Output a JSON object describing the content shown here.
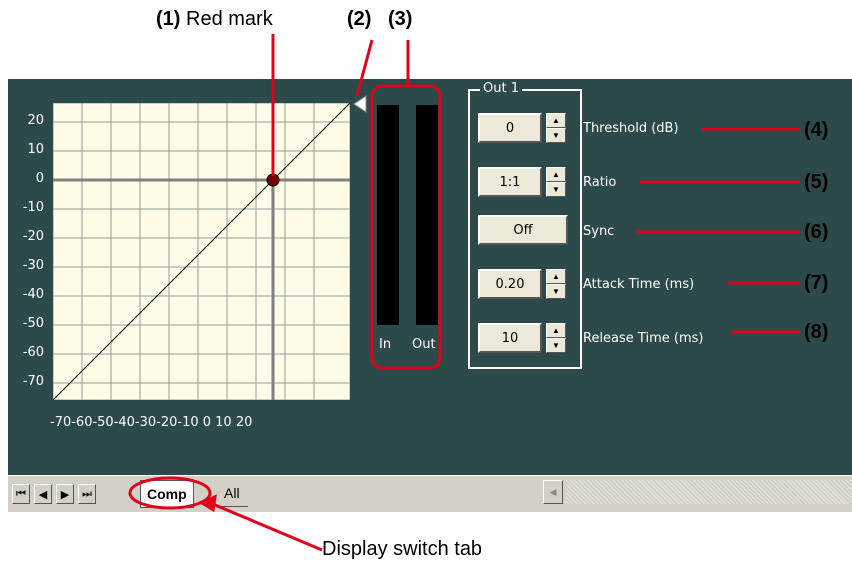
{
  "callouts": {
    "red_mark": {
      "num": "(1)",
      "label": "Red mark"
    },
    "marker": {
      "num": "(2)"
    },
    "meters": {
      "num": "(3)"
    },
    "threshold": {
      "num": "(4)"
    },
    "ratio": {
      "num": "(5)"
    },
    "sync": {
      "num": "(6)"
    },
    "attack": {
      "num": "(7)"
    },
    "release": {
      "num": "(8)"
    },
    "display_switch": "Display switch tab"
  },
  "graph": {
    "y_ticks": [
      "20",
      "10",
      "0",
      "-10",
      "-20",
      "-30",
      "-40",
      "-50",
      "-60",
      "-70"
    ],
    "x_ticks_text": "-70-60-50-40-30-20-10  0  10  20",
    "mark": {
      "x": 0,
      "y": 0
    }
  },
  "meters": {
    "in_label": "In",
    "out_label": "Out"
  },
  "group": {
    "title": "Out 1",
    "threshold": {
      "value": "0",
      "label": "Threshold (dB)"
    },
    "ratio": {
      "value": "1:1",
      "label": "Ratio"
    },
    "sync": {
      "value": "Off",
      "label": "Sync"
    },
    "attack": {
      "value": "0.20",
      "label": "Attack Time (ms)"
    },
    "release": {
      "value": "10",
      "label": "Release Time (ms)"
    }
  },
  "tabs": {
    "comp": "Comp",
    "all": "All"
  },
  "colors": {
    "panel": "#2c4a49",
    "graph_bg": "#fffde8",
    "callout_red": "#e0001b",
    "mark": "#7a0000"
  }
}
